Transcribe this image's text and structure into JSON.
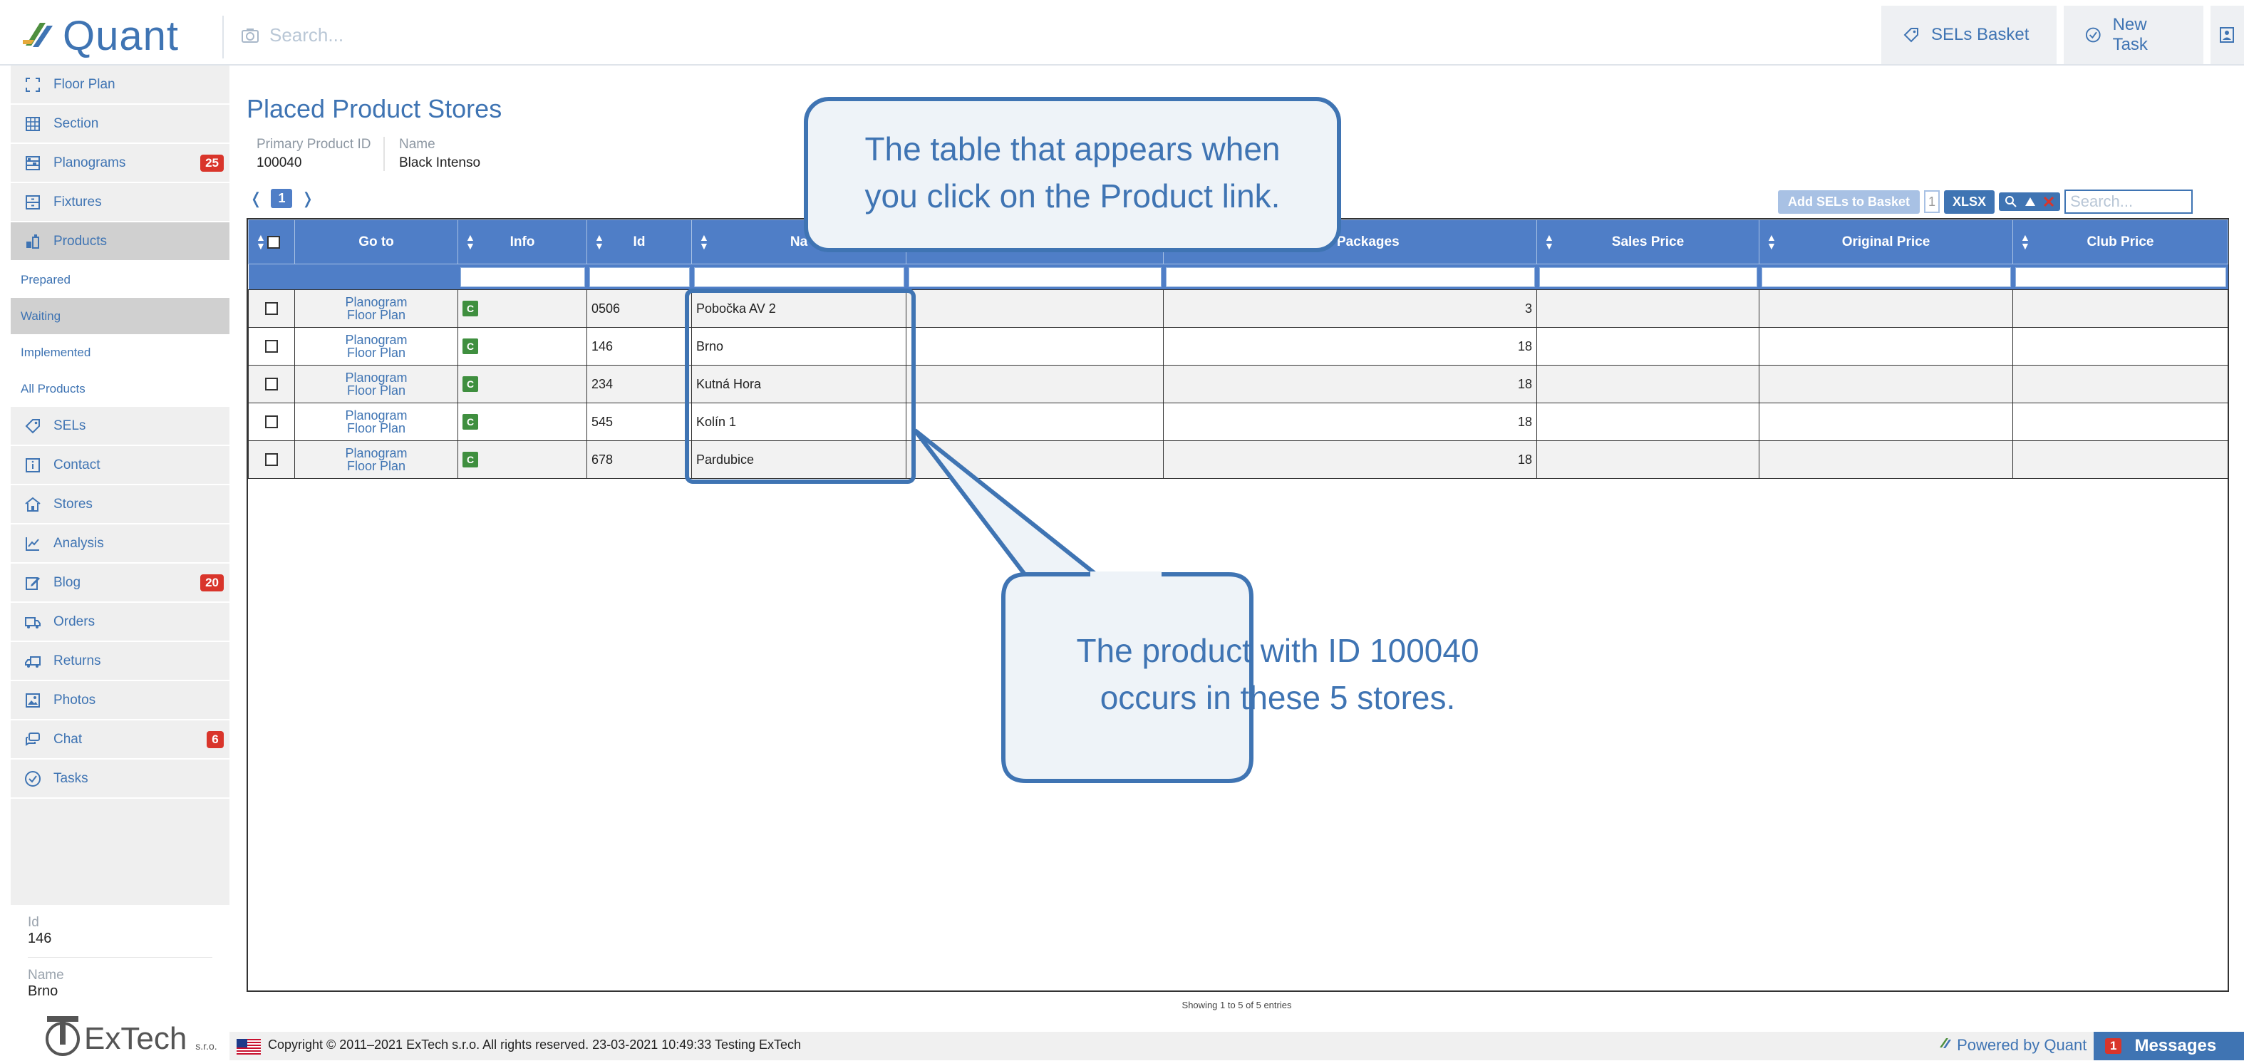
{
  "app": {
    "brand": "Quant",
    "search_placeholder": "Search...",
    "sels_basket": "SELs Basket",
    "new_task": "New Task"
  },
  "sidebar": {
    "items": [
      {
        "label": "Floor Plan"
      },
      {
        "label": "Section"
      },
      {
        "label": "Planograms",
        "badge": "25"
      },
      {
        "label": "Fixtures"
      },
      {
        "label": "Products"
      }
    ],
    "sub": [
      {
        "label": "Prepared"
      },
      {
        "label": "Waiting"
      },
      {
        "label": "Implemented"
      },
      {
        "label": "All Products"
      }
    ],
    "items2": [
      {
        "label": "SELs"
      },
      {
        "label": "Contact"
      },
      {
        "label": "Stores"
      },
      {
        "label": "Analysis"
      },
      {
        "label": "Blog",
        "badge": "20"
      },
      {
        "label": "Orders"
      },
      {
        "label": "Returns"
      },
      {
        "label": "Photos"
      },
      {
        "label": "Chat",
        "badge": "6"
      },
      {
        "label": "Tasks"
      }
    ],
    "detail": {
      "id_label": "Id",
      "id_value": "146",
      "name_label": "Name",
      "name_value": "Brno"
    }
  },
  "footer_logo": "ExTech",
  "footer_logo_suffix": "s.r.o.",
  "page": {
    "title": "Placed Product Stores",
    "primary_label": "Primary Product ID",
    "primary_value": "100040",
    "name_label": "Name",
    "name_value": "Black Intenso"
  },
  "pagination": {
    "prev": "❬",
    "current": "1",
    "next": "❭"
  },
  "toolbar": {
    "add_sels": "Add SELs to Basket",
    "basket_count": "1",
    "xlsx": "XLSX",
    "search_placeholder": "Search..."
  },
  "table": {
    "headers": [
      "Go to",
      "Info",
      "Id",
      "Na",
      "",
      "nned Packages",
      "Sales Price",
      "Original Price",
      "Club Price"
    ],
    "rows": [
      {
        "go1": "Planogram",
        "go2": "Floor Plan",
        "info": "C",
        "id": "0506",
        "name": "Pobočka AV 2",
        "col6": "",
        "packages": "3",
        "sales": "",
        "original": "",
        "club": ""
      },
      {
        "go1": "Planogram",
        "go2": "Floor Plan",
        "info": "C",
        "id": "146",
        "name": "Brno",
        "col6": "",
        "packages": "18",
        "sales": "",
        "original": "",
        "club": ""
      },
      {
        "go1": "Planogram",
        "go2": "Floor Plan",
        "info": "C",
        "id": "234",
        "name": "Kutná Hora",
        "col6": "",
        "packages": "18",
        "sales": "",
        "original": "",
        "club": ""
      },
      {
        "go1": "Planogram",
        "go2": "Floor Plan",
        "info": "C",
        "id": "545",
        "name": "Kolín 1",
        "col6": "",
        "packages": "18",
        "sales": "",
        "original": "",
        "club": ""
      },
      {
        "go1": "Planogram",
        "go2": "Floor Plan",
        "info": "C",
        "id": "678",
        "name": "Pardubice",
        "col6": "",
        "packages": "18",
        "sales": "",
        "original": "",
        "club": ""
      }
    ],
    "showing": "Showing 1 to 5 of 5 entries"
  },
  "callouts": {
    "top_line1": "The table that appears when",
    "top_line2": "you click on the Product link.",
    "bottom_line1": "The product with ID 100040",
    "bottom_line2": "occurs in these 5 stores."
  },
  "footer": {
    "copyright": "Copyright © 2011–2021 ExTech s.r.o. All rights reserved. 23-03-2021 10:49:33  Testing ExTech",
    "powered": "Powered by Quant",
    "messages": "Messages",
    "messages_count": "1"
  },
  "colors": {
    "accent": "#3f74b3",
    "header_blue": "#4f7ec7",
    "badge_red": "#d9352b",
    "info_green": "#3f8f3f"
  }
}
